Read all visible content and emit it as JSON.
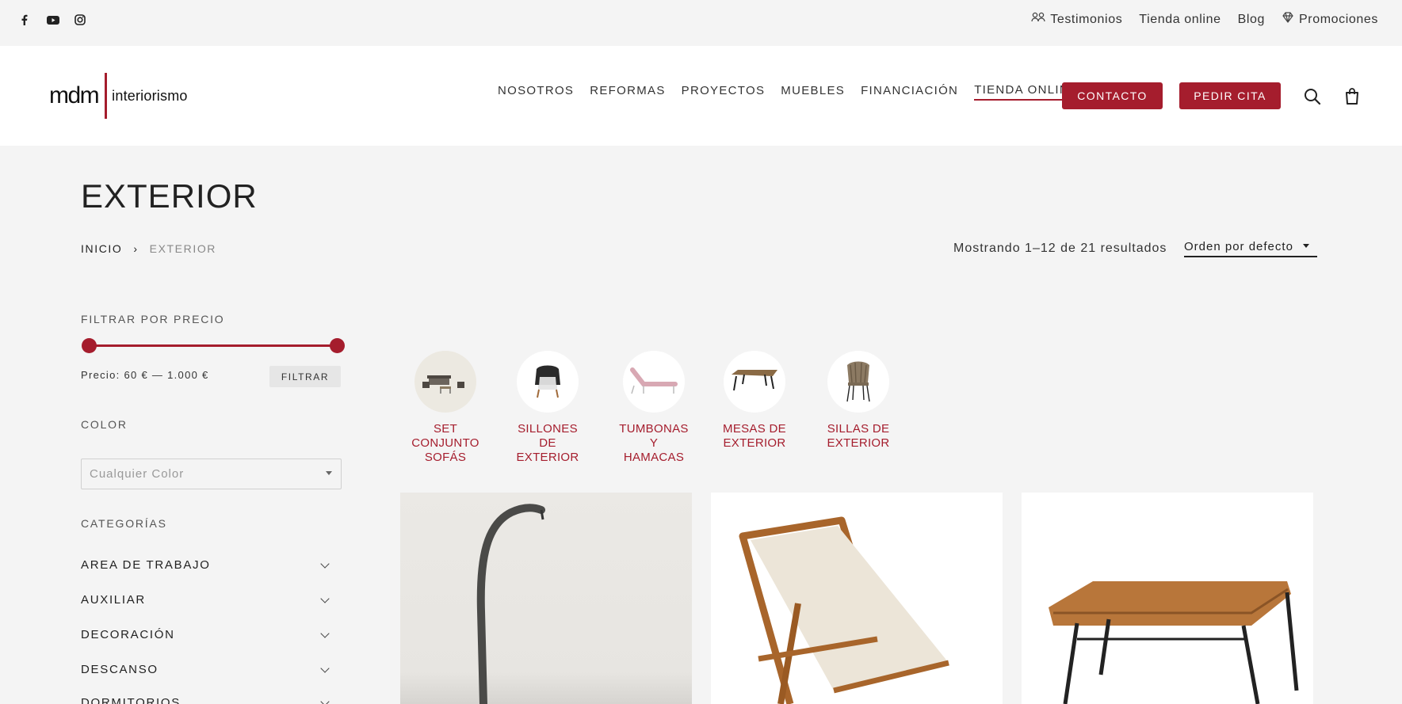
{
  "topbar": {
    "social": [
      "facebook-icon",
      "youtube-icon",
      "instagram-icon"
    ],
    "links": [
      {
        "label": "Testimonios",
        "icon": "people-icon"
      },
      {
        "label": "Tienda online",
        "icon": ""
      },
      {
        "label": "Blog",
        "icon": ""
      },
      {
        "label": "Promociones",
        "icon": "diamond-icon"
      }
    ]
  },
  "header": {
    "logo_main": "mdm",
    "logo_sub": "interiorismo",
    "nav": [
      "NOSOTROS",
      "REFORMAS",
      "PROYECTOS",
      "MUEBLES",
      "FINANCIACIÓN",
      "TIENDA ONLINE"
    ],
    "active_nav": "TIENDA ONLINE",
    "contact_label": "CONTACTO",
    "appointment_label": "PEDIR CITA"
  },
  "page": {
    "title": "EXTERIOR",
    "breadcrumb": {
      "home": "INICIO",
      "separator": "›",
      "current": "EXTERIOR"
    },
    "results": "Mostrando 1–12 de 21 resultados",
    "orderby": "Orden por defecto"
  },
  "sidebar": {
    "price_heading": "FILTRAR POR PRECIO",
    "price_text": "Precio: 60 € — 1.000 €",
    "price_range": [
      60,
      1000
    ],
    "filter_button": "FILTRAR",
    "color_heading": "COLOR",
    "color_placeholder": "Cualquier Color",
    "categories_heading": "CATEGORÍAS",
    "categories": [
      "AREA DE TRABAJO",
      "AUXILIAR",
      "DECORACIÓN",
      "DESCANSO",
      "DORMITORIOS"
    ]
  },
  "subcategories": [
    {
      "label": "SET CONJUNTO SOFÁS",
      "lines": [
        "SET",
        "CONJUNTO",
        "SOFÁS"
      ]
    },
    {
      "label": "SILLONES DE EXTERIOR",
      "lines": [
        "SILLONES",
        "DE",
        "EXTERIOR"
      ]
    },
    {
      "label": "TUMBONAS Y HAMACAS",
      "lines": [
        "TUMBONAS",
        "Y",
        "HAMACAS"
      ]
    },
    {
      "label": "MESAS DE EXTERIOR",
      "lines": [
        "MESAS DE",
        "EXTERIOR"
      ]
    },
    {
      "label": "SILLAS DE EXTERIOR",
      "lines": [
        "SILLAS DE",
        "EXTERIOR"
      ]
    }
  ],
  "colors": {
    "accent": "#a51d2d",
    "background": "#f4f4f4",
    "header": "#ffffff"
  }
}
